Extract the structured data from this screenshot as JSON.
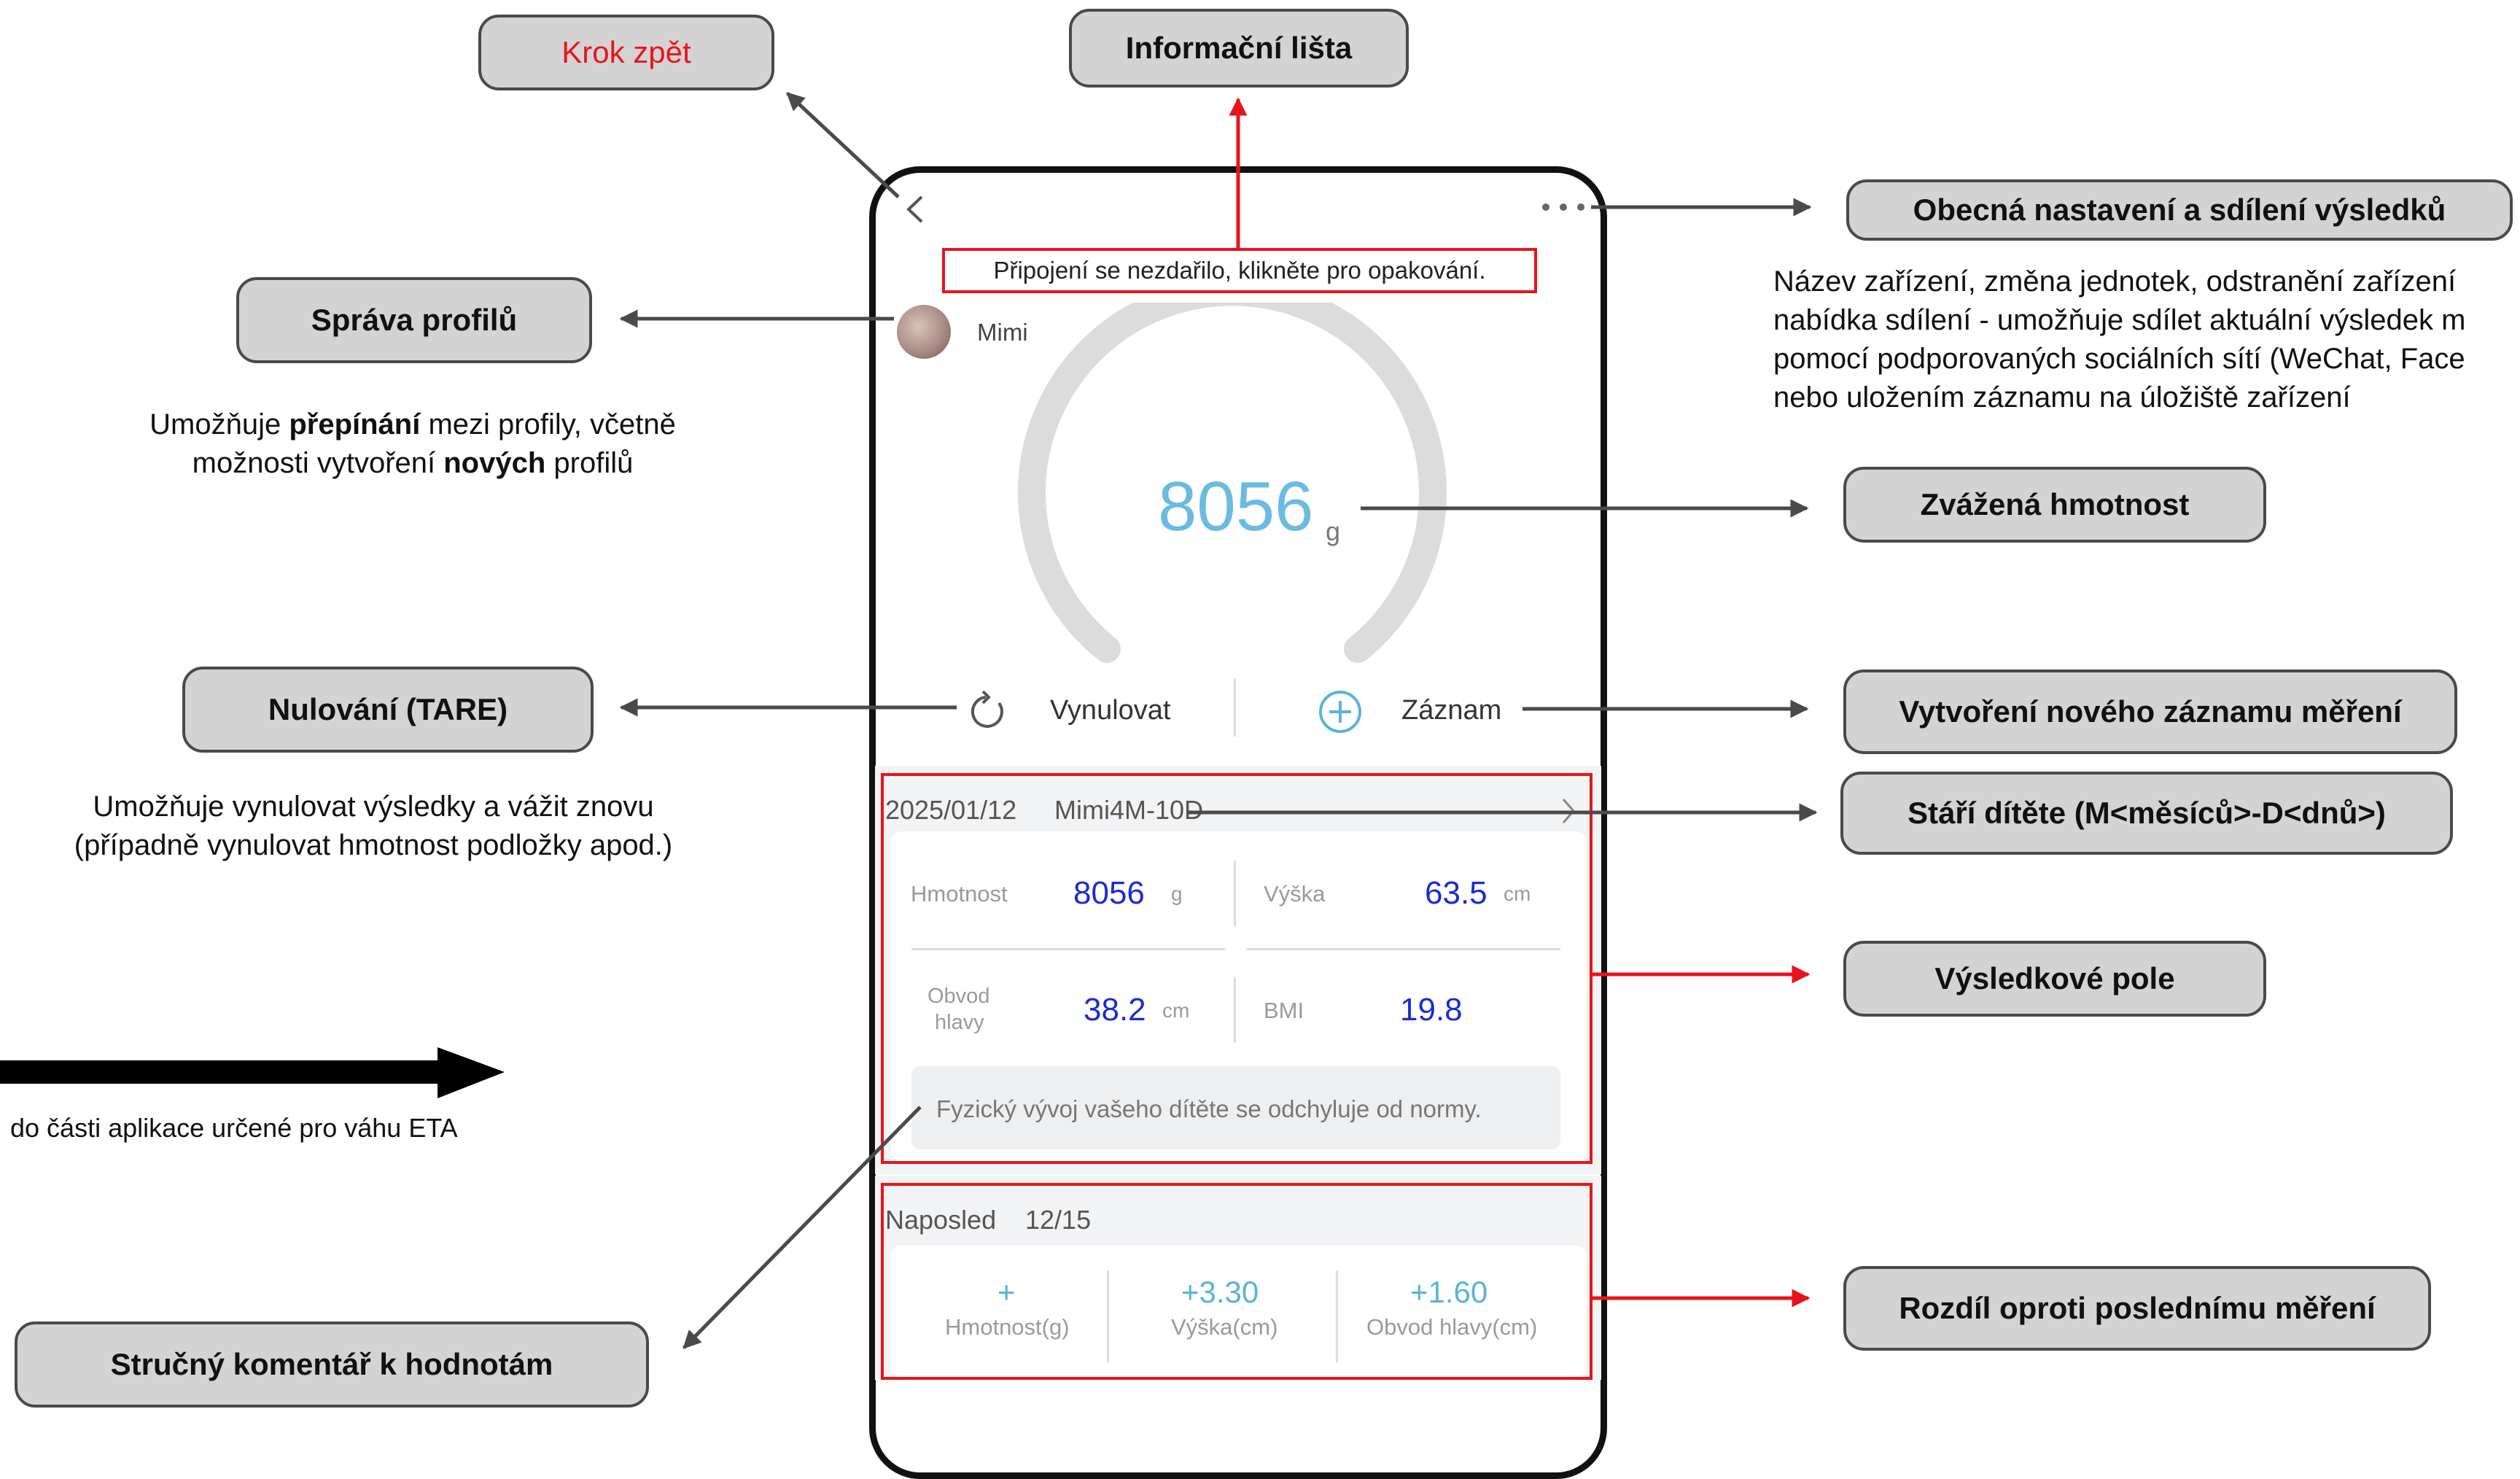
{
  "callouts": {
    "back": "Krok zpět",
    "info_bar": "Informační lišta",
    "general_settings": "Obecná nastavení a sdílení výsledků",
    "profiles": "Správa profilů",
    "weighed": "Zvážená hmotnost",
    "tare": "Nulování (TARE)",
    "new_record": "Vytvoření nového záznamu měření",
    "child_age": "Stáří dítěte (M<měsíců>-D<dnů>)",
    "results": "Výsledkové pole",
    "comment": "Stručný komentář k hodnotám",
    "difference": "Rozdíl oproti poslednímu měření"
  },
  "descriptions": {
    "settings_lines": [
      "Název zařízení, změna jednotek, odstranění zařízení",
      "nabídka sdílení - umožňuje sdílet aktuální výsledek m",
      "pomocí podporovaných sociálních sítí (WeChat, Face",
      "nebo uložením záznamu na úložiště zařízení"
    ],
    "profiles_line1_a": "Umožňuje ",
    "profiles_line1_b": "přepínání",
    "profiles_line1_c": " mezi profily, včetně",
    "profiles_line2_a": "možnosti vytvoření ",
    "profiles_line2_b": "nových",
    "profiles_line2_c": " profilů",
    "tare_line1": "Umožňuje vynulovat výsledky a vážit znovu",
    "tare_line2": "(případně vynulovat hmotnost podložky apod.)",
    "eta": "do části aplikace určené pro váhu ETA"
  },
  "app": {
    "info_bar_text": "Připojení se nezdařilo, klikněte pro opakování.",
    "profile_name": "Mimi",
    "weight_value": "8056",
    "weight_unit": "g",
    "tare_label": "Vynulovat",
    "record_label": "Záznam",
    "record_header_date": "2025/01/12",
    "record_header_name": "Mimi4M-10D",
    "weight_label": "Hmotnost",
    "weight_result": "8056",
    "weight_result_unit": "g",
    "height_label": "Výška",
    "height_result": "63.5",
    "height_unit": "cm",
    "head_label_1": "Obvod",
    "head_label_2": "hlavy",
    "head_result": "38.2",
    "head_unit": "cm",
    "bmi_label": "BMI",
    "bmi_result": "19.8",
    "comment_text": "Fyzický vývoj vašeho dítěte se odchyluje od normy.",
    "last_label": "Naposled",
    "last_date": "12/15",
    "diff_weight": "+",
    "diff_weight_label": "Hmotnost(g)",
    "diff_height": "+3.30",
    "diff_height_label": "Výška(cm)",
    "diff_head": "+1.60",
    "diff_head_label": "Obvod hlavy(cm)"
  },
  "colors": {
    "callout_bg": "#d3d3d3",
    "annotation_red": "#e8141c",
    "gauge_grey": "#dcdcdc",
    "weight_cyan": "#6bbbe0",
    "result_blue": "#1a2bd6"
  }
}
